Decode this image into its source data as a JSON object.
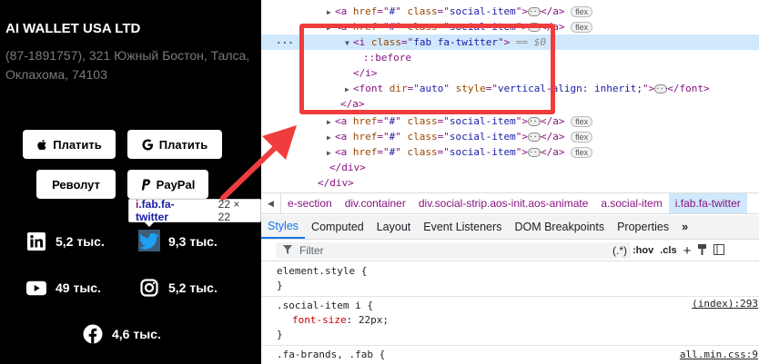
{
  "webpage": {
    "company_name": "AI WALLET USA LTD",
    "address": "(87-1891757), 321 Южный Бостон, Талса, Оклахома, 74103",
    "payment_buttons": [
      {
        "label": "Платить",
        "icon": "apple-icon"
      },
      {
        "label": "Платить",
        "icon": "google-icon"
      },
      {
        "label": "Револут",
        "icon": ""
      },
      {
        "label": "PayPal",
        "icon": "paypal-icon"
      }
    ],
    "socials": [
      {
        "network": "linkedin",
        "icon": "linkedin-icon",
        "count": "5,2 тыс."
      },
      {
        "network": "twitter",
        "icon": "twitter-icon",
        "count": "9,3 тыс."
      },
      {
        "network": "youtube",
        "icon": "youtube-icon",
        "count": "49 тыс."
      },
      {
        "network": "instagram",
        "icon": "instagram-icon",
        "count": "5,2 тыс."
      },
      {
        "network": "facebook",
        "icon": "facebook-icon",
        "count": "4,6 тыс."
      }
    ],
    "inspect_tooltip": {
      "tag": "i",
      "classes": ".fab.fa-twitter",
      "size": "22 × 22"
    }
  },
  "devtools": {
    "dom": {
      "href_attr": "href",
      "class_attr": "class",
      "href_val": "#",
      "class_val": "social-item",
      "badge": "flex",
      "i_class_val": "fab fa-twitter",
      "selected_marker": "== $0",
      "pseudo_before": "::before",
      "close_i": "</i>",
      "font_dir_attr": "dir",
      "font_dir_val": "auto",
      "font_style_attr": "style",
      "font_style_val": "vertical-align: inherit;",
      "close_a": "</a>",
      "close_div": "</div>",
      "ellipsis": "…"
    },
    "breadcrumbs": [
      "e-section",
      "div.container",
      "div.social-strip.aos-init.aos-animate",
      "a.social-item",
      "i.fab.fa-twitter"
    ],
    "tabs": [
      "Styles",
      "Computed",
      "Layout",
      "Event Listeners",
      "DOM Breakpoints",
      "Properties",
      "»"
    ],
    "active_tab": "Styles",
    "filter": {
      "placeholder": "Filter",
      "hov": ":hov",
      "cls": ".cls",
      "pseudo_hint": "(.*)"
    },
    "styles": {
      "element_style": "element.style {",
      "close_brace": "}",
      "rule1_selector": ".social-item i {",
      "rule1_prop": "font-size",
      "rule1_value": "22px;",
      "rule1_source": "(index):293",
      "rule2_selector": ".fa-brands, .fab {",
      "rule2_source": "all.min.css:9"
    }
  },
  "colors": {
    "annotation_red": "#ef3d3d",
    "selection_blue": "#cfe8fc",
    "tab_active": "#1a73e8"
  }
}
